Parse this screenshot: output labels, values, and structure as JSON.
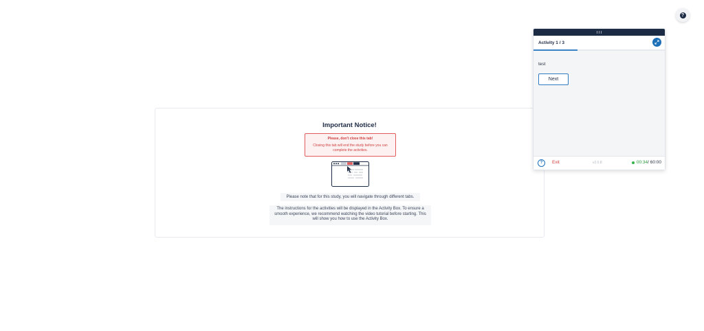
{
  "help_fab": {
    "icon": "question-icon",
    "glyph": "?"
  },
  "notice": {
    "title": "Important Notice!",
    "warning_title": "Please, don't close this tab!",
    "warning_body": "Closing this tab will end the study before you can complete the activities.",
    "note_tabs": "Please note that for this study, you will navigate through different tabs.",
    "note_activity_box": "The instructions for the activities will be displayed in the Activity Box. To ensure a smooth experience, we recommend watching the video tutorial before starting. This will show you how to use the Activity Box."
  },
  "activity_box": {
    "title": "Activity 1 / 3",
    "progress_fraction": 0.333,
    "content_text": "test",
    "next_label": "Next",
    "help_glyph": "?",
    "exit_label": "Exit",
    "version": "v2.0.8",
    "timer_elapsed": "00:34",
    "timer_total": "/ 60:00"
  },
  "colors": {
    "primary_dark": "#1c2b44",
    "accent_blue": "#1d6fb8",
    "danger": "#d23c3c",
    "success": "#38b24a"
  }
}
